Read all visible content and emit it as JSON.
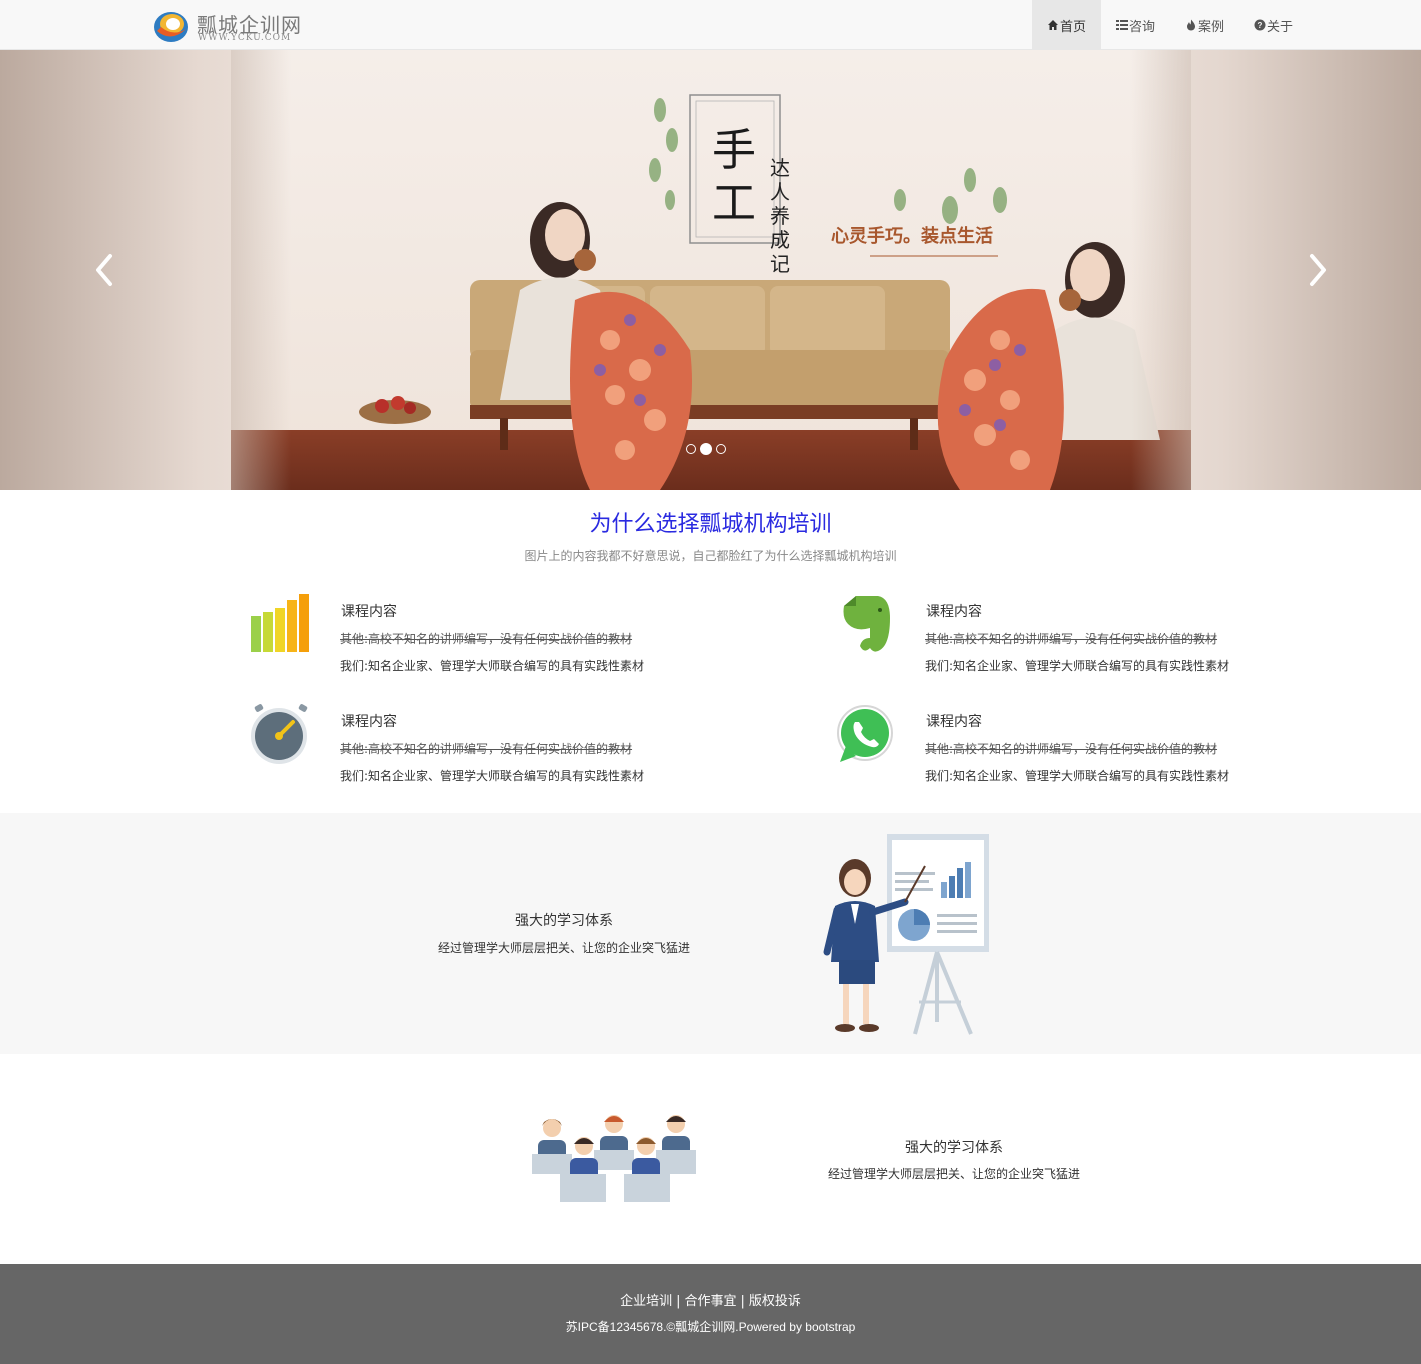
{
  "navbar": {
    "brand_title": "瓢城企训网",
    "brand_sub": "WWW.YCKU.COM",
    "items": [
      {
        "label": "首页",
        "icon": "home-icon",
        "active": true
      },
      {
        "label": "咨询",
        "icon": "list-icon",
        "active": false
      },
      {
        "label": "案例",
        "icon": "fire-icon",
        "active": false
      },
      {
        "label": "关于",
        "icon": "question-circle-icon",
        "active": false
      }
    ]
  },
  "carousel": {
    "headline_big_1": "手",
    "headline_big_2": "工",
    "headline_vertical": [
      "达",
      "人",
      "养",
      "成",
      "记"
    ],
    "tagline": "心灵手巧。装点生活",
    "slide_count": 3,
    "active_slide": 2,
    "prev_icon": "chevron-left-icon",
    "next_icon": "chevron-right-icon"
  },
  "why": {
    "title": "为什么选择瓢城机构培训",
    "subtitle": "图片上的内容我都不好意思说，自己都脸红了为什么选择瓢城机构培训",
    "features": [
      {
        "icon": "bar-chart-icon",
        "title": "课程内容",
        "old": "其他:高校不知名的讲师编写，没有任何实战价值的教材",
        "new": "我们:知名企业家、管理学大师联合编写的具有实践性素材"
      },
      {
        "icon": "evernote-elephant-icon",
        "title": "课程内容",
        "old": "其他:高校不知名的讲师编写，没有任何实战价值的教材",
        "new": "我们:知名企业家、管理学大师联合编写的具有实践性素材"
      },
      {
        "icon": "stopwatch-icon",
        "title": "课程内容",
        "old": "其他:高校不知名的讲师编写，没有任何实战价值的教材",
        "new": "我们:知名企业家、管理学大师联合编写的具有实践性素材"
      },
      {
        "icon": "whatsapp-icon",
        "title": "课程内容",
        "old": "其他:高校不知名的讲师编写，没有任何实战价值的教材",
        "new": "我们:知名企业家、管理学大师联合编写的具有实践性素材"
      }
    ]
  },
  "section1": {
    "heading": "强大的学习体系",
    "text": "经过管理学大师层层把关、让您的企业突飞猛进",
    "illustration": "presenter-illustration"
  },
  "section2": {
    "heading": "强大的学习体系",
    "text": "经过管理学大师层层把关、让您的企业突飞猛进",
    "illustration": "call-center-team-illustration"
  },
  "footer": {
    "links": [
      "企业培训",
      "合作事宜",
      "版权投诉"
    ],
    "separator": "|",
    "copyright": "苏IPC备12345678.©瓢城企训网.Powered by bootstrap"
  },
  "colors": {
    "title_blue": "#2a2ae0",
    "navbar_bg": "#f8f8f8",
    "footer_bg": "#666666",
    "gray_section": "#f7f7f7"
  }
}
